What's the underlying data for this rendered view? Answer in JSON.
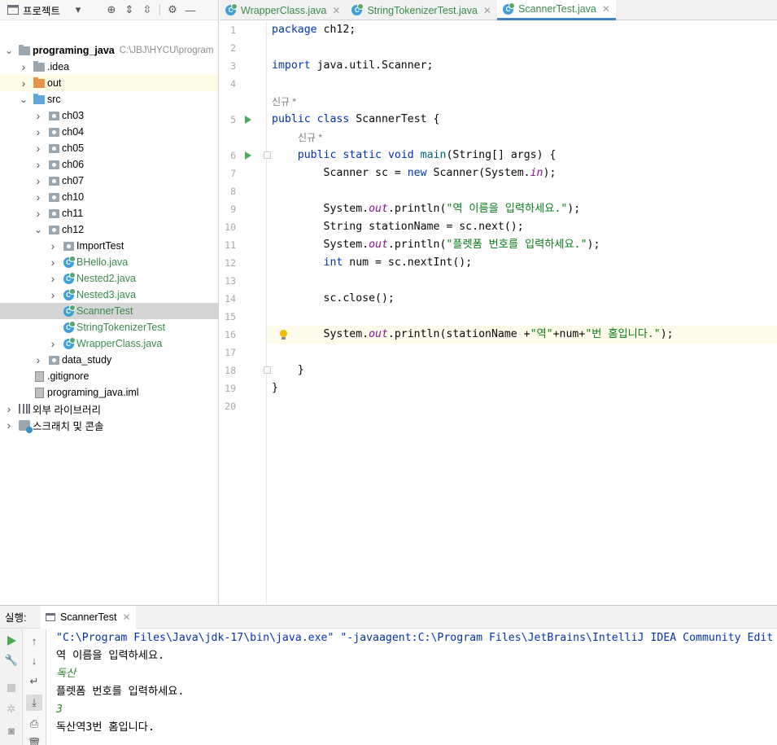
{
  "project_panel": {
    "title": "프로젝트",
    "tree": [
      {
        "label": "programing_java",
        "path": "C:\\JBJ\\HYCU\\program",
        "type": "module",
        "expanded": true,
        "bold": true,
        "indent": 0
      },
      {
        "label": ".idea",
        "type": "folder",
        "expanded": false,
        "indent": 1
      },
      {
        "label": "out",
        "type": "folder-out",
        "expanded": false,
        "indent": 1,
        "highlight": true
      },
      {
        "label": "src",
        "type": "folder-src",
        "expanded": true,
        "indent": 1
      },
      {
        "label": "ch03",
        "type": "package",
        "expanded": false,
        "indent": 2
      },
      {
        "label": "ch04",
        "type": "package",
        "expanded": false,
        "indent": 2
      },
      {
        "label": "ch05",
        "type": "package",
        "expanded": false,
        "indent": 2
      },
      {
        "label": "ch06",
        "type": "package",
        "expanded": false,
        "indent": 2
      },
      {
        "label": "ch07",
        "type": "package",
        "expanded": false,
        "indent": 2
      },
      {
        "label": "ch10",
        "type": "package",
        "expanded": false,
        "indent": 2
      },
      {
        "label": "ch11",
        "type": "package",
        "expanded": false,
        "indent": 2
      },
      {
        "label": "ch12",
        "type": "package",
        "expanded": true,
        "indent": 2
      },
      {
        "label": "ImportTest",
        "type": "package",
        "expanded": false,
        "indent": 3
      },
      {
        "label": "BHello.java",
        "type": "class",
        "expanded": false,
        "indent": 3,
        "green": true
      },
      {
        "label": "Nested2.java",
        "type": "class",
        "expanded": false,
        "indent": 3,
        "green": true
      },
      {
        "label": "Nested3.java",
        "type": "class",
        "expanded": false,
        "indent": 3,
        "green": true
      },
      {
        "label": "ScannerTest",
        "type": "class",
        "indent": 3,
        "green": true,
        "selected": true,
        "leaf": true
      },
      {
        "label": "StringTokenizerTest",
        "type": "class",
        "indent": 3,
        "green": true,
        "leaf": true
      },
      {
        "label": "WrapperClass.java",
        "type": "class",
        "expanded": false,
        "indent": 3,
        "green": true
      },
      {
        "label": "data_study",
        "type": "package",
        "expanded": false,
        "indent": 2
      },
      {
        "label": ".gitignore",
        "type": "file",
        "indent": 1,
        "leaf": true
      },
      {
        "label": "programing_java.iml",
        "type": "file",
        "indent": 1,
        "leaf": true
      },
      {
        "label": "외부 라이브러리",
        "type": "library",
        "expanded": false,
        "indent": 0
      },
      {
        "label": "스크래치 및 콘솔",
        "type": "scratch",
        "expanded": false,
        "indent": 0
      }
    ]
  },
  "tabs": [
    {
      "label": "WrapperClass.java",
      "active": false
    },
    {
      "label": "StringTokenizerTest.java",
      "active": false
    },
    {
      "label": "ScannerTest.java",
      "active": true
    }
  ],
  "editor": {
    "hints": [
      {
        "line_after": 4,
        "text": "신규 *",
        "indent": 0
      },
      {
        "line_after": 5,
        "text": "신규 *",
        "indent": 1
      }
    ],
    "lines": [
      "package ch12;",
      "",
      "import java.util.Scanner;",
      "",
      "public class ScannerTest {",
      "    public static void main(String[] args) {",
      "        Scanner sc = new Scanner(System.in);",
      "",
      "        System.out.println(\"역 이름을 입력하세요.\");",
      "        String stationName = sc.next();",
      "        System.out.println(\"플렛폼 번호를 입력하세요.\");",
      "        int num = sc.nextInt();",
      "",
      "        sc.close();",
      "",
      "        System.out.println(stationName +\"역\"+num+\"번 홈입니다.\");",
      "",
      "    }",
      "}",
      ""
    ],
    "run_lines": [
      5,
      6
    ],
    "current_line": 16
  },
  "run_panel": {
    "label": "실행:",
    "tab": "ScannerTest",
    "console": [
      {
        "text": "\"C:\\Program Files\\Java\\jdk-17\\bin\\java.exe\" \"-javaagent:C:\\Program Files\\JetBrains\\IntelliJ IDEA Community Edit",
        "kind": "cmd"
      },
      {
        "text": "역 이름을 입력하세요.",
        "kind": "out"
      },
      {
        "text": "독산",
        "kind": "in"
      },
      {
        "text": "플렛폼 번호를 입력하세요.",
        "kind": "out"
      },
      {
        "text": "3",
        "kind": "in"
      },
      {
        "text": "독산역3번 홈입니다.",
        "kind": "out"
      }
    ]
  }
}
